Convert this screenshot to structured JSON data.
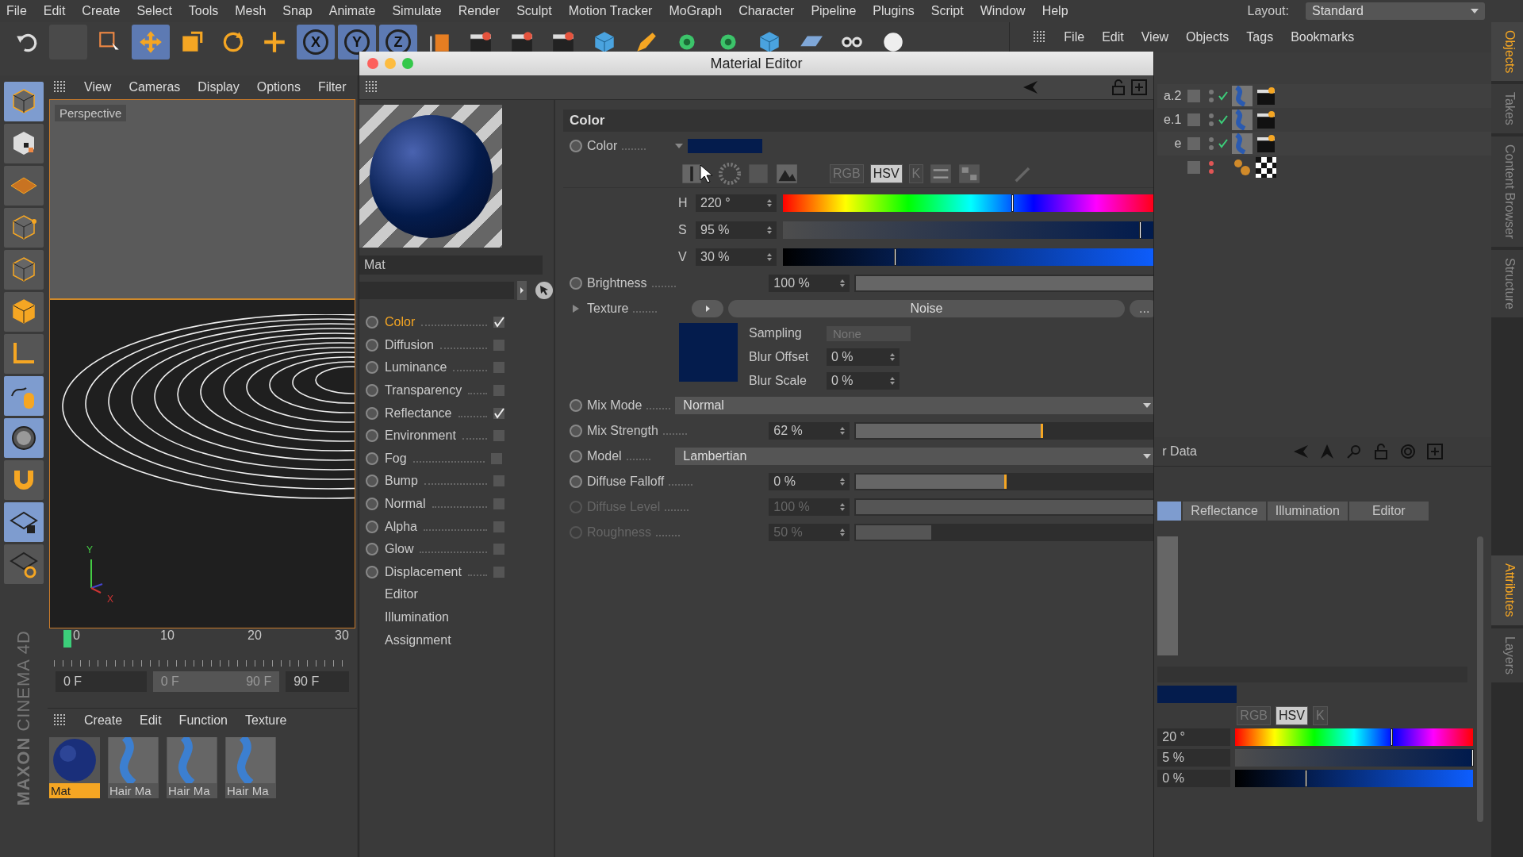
{
  "menu_bar": {
    "items": [
      "File",
      "Edit",
      "Create",
      "Select",
      "Tools",
      "Mesh",
      "Snap",
      "Animate",
      "Simulate",
      "Render",
      "Sculpt",
      "Motion Tracker",
      "MoGraph",
      "Character",
      "Pipeline",
      "Plugins",
      "Script",
      "Window",
      "Help"
    ],
    "layout_label": "Layout:",
    "layout_value": "Standard"
  },
  "toolbar": [
    {
      "kind": "undo",
      "active": false
    },
    {
      "kind": "blank",
      "active": false
    },
    {
      "kind": "select",
      "active": false
    },
    {
      "kind": "move",
      "active": true
    },
    {
      "kind": "scale",
      "active": false
    },
    {
      "kind": "rotate",
      "active": false
    },
    {
      "kind": "add",
      "active": false
    },
    {
      "kind": "axis",
      "label": "X",
      "active": true
    },
    {
      "kind": "axis",
      "label": "Y",
      "active": true
    },
    {
      "kind": "axis",
      "label": "Z",
      "active": true
    },
    {
      "kind": "coords",
      "active": false
    },
    {
      "kind": "clapper",
      "active": false
    },
    {
      "kind": "clapper",
      "active": false
    },
    {
      "kind": "clapper",
      "active": false
    },
    {
      "kind": "cube",
      "active": false
    },
    {
      "kind": "pen",
      "active": false
    },
    {
      "kind": "gear",
      "active": false
    },
    {
      "kind": "gear",
      "active": false
    },
    {
      "kind": "cube",
      "active": false
    },
    {
      "kind": "grid",
      "active": false
    },
    {
      "kind": "camera",
      "active": false
    },
    {
      "kind": "light",
      "active": false
    }
  ],
  "tool_palette": [
    {
      "kind": "cube",
      "active": true
    },
    {
      "kind": "checker",
      "active": false
    },
    {
      "kind": "grid",
      "active": false
    },
    {
      "kind": "points",
      "active": false
    },
    {
      "kind": "edges",
      "active": false
    },
    {
      "kind": "polys",
      "active": false
    },
    {
      "kind": "axis",
      "active": false
    },
    {
      "kind": "mouse",
      "active": true
    },
    {
      "kind": "snap",
      "active": true
    },
    {
      "kind": "magnet",
      "active": false
    },
    {
      "kind": "gridlock",
      "active": true
    },
    {
      "kind": "gridsync",
      "active": false
    }
  ],
  "brand": [
    "MAXON",
    "CINEMA 4D"
  ],
  "viewport": {
    "menu": [
      "View",
      "Cameras",
      "Display",
      "Options",
      "Filter"
    ],
    "label": "Perspective",
    "axis_y": "Y",
    "axis_x": "X"
  },
  "timeline": {
    "ticks": [
      "0",
      "10",
      "20",
      "30"
    ],
    "current_frame": "0 F",
    "range_start": "0 F",
    "range_end": "90 F",
    "end_frame": "90 F"
  },
  "material_manager": {
    "menu": [
      "Create",
      "Edit",
      "Function",
      "Texture"
    ],
    "materials": [
      {
        "name": "Mat",
        "kind": "sphere",
        "selected": true
      },
      {
        "name": "Hair Ma",
        "kind": "hair",
        "selected": false
      },
      {
        "name": "Hair Ma",
        "kind": "hair",
        "selected": false
      },
      {
        "name": "Hair Ma",
        "kind": "hair",
        "selected": false
      }
    ]
  },
  "object_manager": {
    "menu": [
      "File",
      "Edit",
      "View",
      "Objects",
      "Tags",
      "Bookmarks"
    ],
    "rows": [
      {
        "name": "a.2",
        "enabled": true,
        "kind": "hair"
      },
      {
        "name": "e.1",
        "enabled": true,
        "kind": "hair"
      },
      {
        "name": "e",
        "enabled": true,
        "kind": "hair"
      },
      {
        "enabled": false,
        "kind": "null"
      }
    ]
  },
  "attributes": {
    "title": "r Data",
    "tabs": [
      {
        "selected": true
      },
      {
        "label": "Reflectance",
        "selected": false
      },
      {
        "label": "Illumination",
        "selected": false
      },
      {
        "label": "Editor",
        "selected": false
      }
    ],
    "modes": [
      {
        "label": "RGB",
        "selected": false
      },
      {
        "label": "HSV",
        "selected": true
      },
      {
        "label": "K",
        "selected": false
      }
    ],
    "hsv": [
      {
        "value": "20 °",
        "level": 0.66
      },
      {
        "value": "5 %",
        "level": 1
      },
      {
        "value": "0 %",
        "level": 0.3
      }
    ]
  },
  "side_tabs_top": [
    {
      "label": "Objects",
      "selected": true
    },
    {
      "label": "Takes",
      "selected": false
    },
    {
      "label": "Content Browser",
      "selected": false
    },
    {
      "label": "Structure",
      "selected": false
    }
  ],
  "side_tabs_bottom": [
    {
      "label": "Attributes",
      "selected": true
    },
    {
      "label": "Layers",
      "selected": false
    }
  ],
  "material_editor": {
    "title": "Material Editor",
    "material_name": "Mat",
    "channels": [
      {
        "kind": "channel",
        "label": "Color",
        "checked": true,
        "selected": true
      },
      {
        "kind": "channel",
        "label": "Diffusion",
        "checked": false,
        "selected": false
      },
      {
        "kind": "channel",
        "label": "Luminance",
        "checked": false,
        "selected": false
      },
      {
        "kind": "channel",
        "label": "Transparency",
        "checked": false,
        "selected": false
      },
      {
        "kind": "channel",
        "label": "Reflectance",
        "checked": true,
        "selected": false
      },
      {
        "kind": "channel",
        "label": "Environment",
        "checked": false,
        "selected": false
      },
      {
        "kind": "channel",
        "label": "Fog",
        "checked": false,
        "selected": false
      },
      {
        "kind": "channel",
        "label": "Bump",
        "checked": false,
        "selected": false
      },
      {
        "kind": "channel",
        "label": "Normal",
        "checked": false,
        "selected": false
      },
      {
        "kind": "channel",
        "label": "Alpha",
        "checked": false,
        "selected": false
      },
      {
        "kind": "channel",
        "label": "Glow",
        "checked": false,
        "selected": false
      },
      {
        "kind": "channel",
        "label": "Displacement",
        "checked": false,
        "selected": false
      },
      {
        "kind": "page",
        "label": "Editor",
        "selected": false
      },
      {
        "kind": "page",
        "label": "Illumination",
        "selected": false
      },
      {
        "kind": "page",
        "label": "Assignment",
        "selected": false
      }
    ],
    "section_title": "Color",
    "color_label": "Color",
    "modes": [
      {
        "label": "RGB",
        "selected": false
      },
      {
        "label": "HSV",
        "selected": true
      },
      {
        "label": "K",
        "selected": false
      }
    ],
    "hsv": [
      {
        "label": "H",
        "value": "220 °",
        "level": 0.611
      },
      {
        "label": "S",
        "value": "95 %",
        "level": 0.95
      },
      {
        "label": "V",
        "value": "30 %",
        "level": 0.3
      }
    ],
    "params": [
      {
        "kind": "slider",
        "label": "Brightness",
        "value": "100 %",
        "level": 1,
        "disabled": false
      },
      {
        "kind": "texture",
        "label": "Texture",
        "value": "Noise",
        "more": "...",
        "sampling_label": "Sampling",
        "sampling": "None",
        "fields": [
          {
            "label": "Blur Offset",
            "value": "0 %"
          },
          {
            "label": "Blur Scale",
            "value": "0 %"
          }
        ]
      },
      {
        "kind": "dropdown",
        "label": "Mix Mode",
        "value": "Normal",
        "disabled": false
      },
      {
        "kind": "slider",
        "label": "Mix Strength",
        "value": "62 %",
        "level": 0.62,
        "disabled": false
      },
      {
        "kind": "dropdown",
        "label": "Model",
        "value": "Lambertian",
        "disabled": false
      },
      {
        "kind": "slider",
        "label": "Diffuse Falloff",
        "value": "0 %",
        "level": 0.5,
        "disabled": false
      },
      {
        "kind": "slider",
        "label": "Diffuse Level",
        "value": "100 %",
        "level": 1,
        "disabled": true
      },
      {
        "kind": "slider",
        "label": "Roughness",
        "value": "50 %",
        "level": 0.25,
        "disabled": true
      }
    ]
  }
}
